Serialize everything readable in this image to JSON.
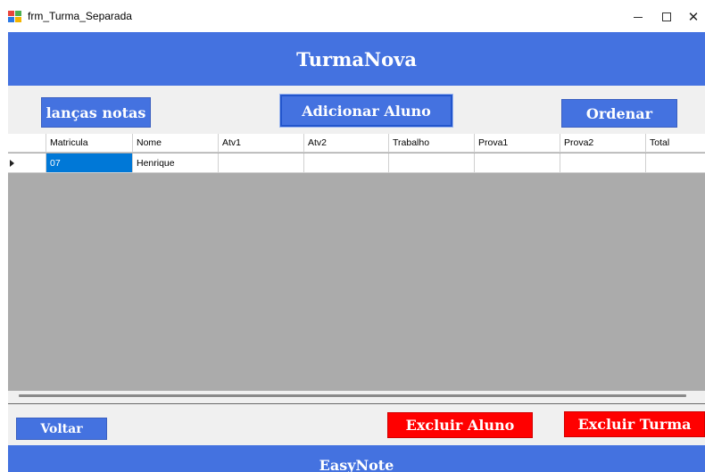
{
  "window": {
    "title": "frm_Turma_Separada",
    "minimize_glyph": "",
    "close_glyph": "✕"
  },
  "header": {
    "title": "TurmaNova"
  },
  "toolbar": {
    "lancas_notas": "lanças notas",
    "adicionar_aluno": "Adicionar Aluno",
    "ordenar": "Ordenar"
  },
  "grid": {
    "columns": [
      "Matricula",
      "Nome",
      "Atv1",
      "Atv2",
      "Trabalho",
      "Prova1",
      "Prova2",
      "Total"
    ],
    "rows": [
      [
        "07",
        "Henrique",
        "",
        "",
        "",
        "",
        "",
        ""
      ]
    ]
  },
  "bottom": {
    "voltar": "Voltar",
    "excluir_aluno": "Excluir Aluno",
    "excluir_turma": "Excluir Turma"
  },
  "footer": {
    "title": "EasyNote"
  },
  "colors": {
    "accent_blue": "#4472e0",
    "danger_red": "#ff0000",
    "grid_background": "#ababab",
    "selection": "#0078d7"
  },
  "icons": [
    "app-icon",
    "minimize-icon",
    "maximize-icon",
    "close-icon",
    "row-indicator-icon"
  ]
}
